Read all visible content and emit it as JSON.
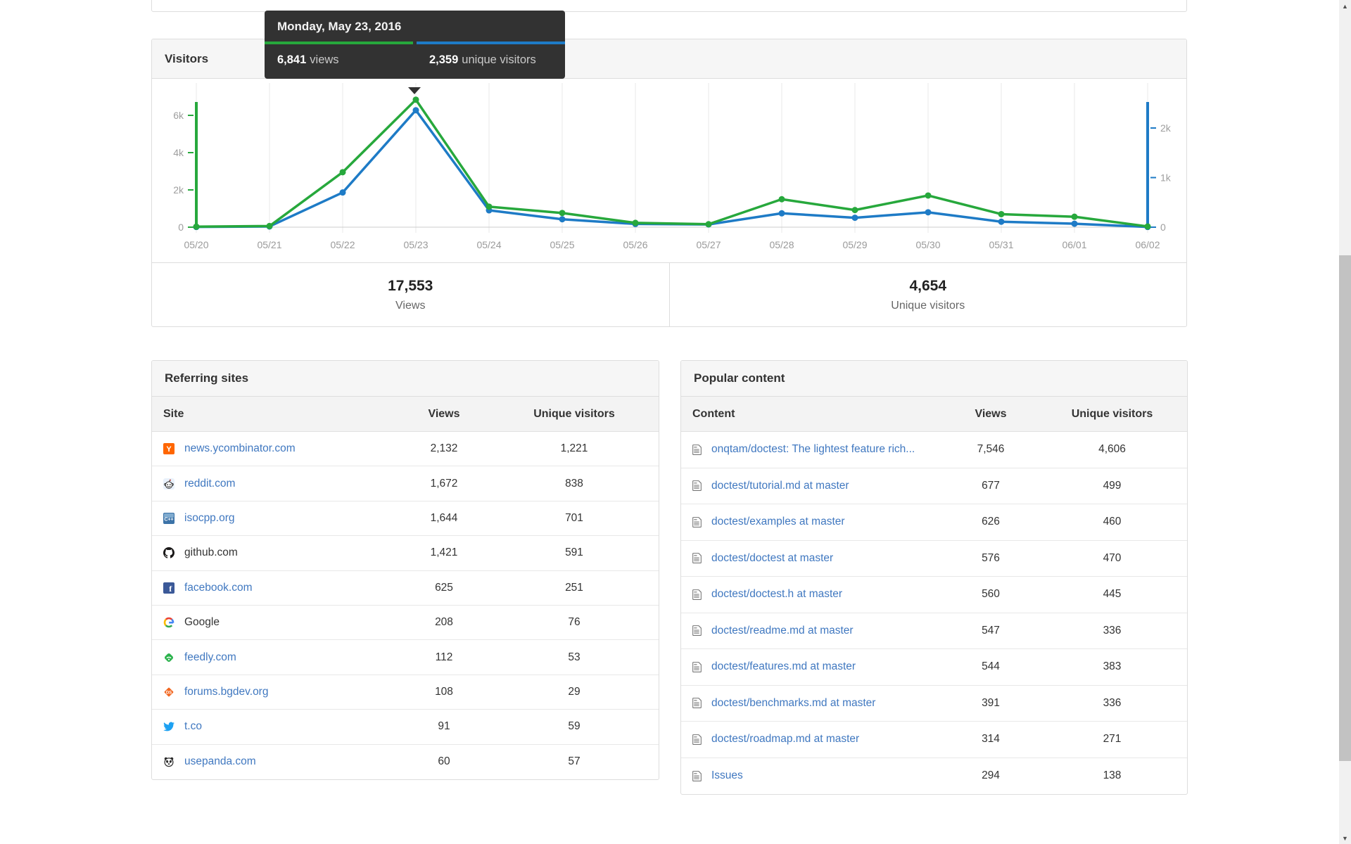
{
  "tooltip": {
    "date": "Monday, May 23, 2016",
    "views_value": "6,841",
    "views_label": "views",
    "unique_value": "2,359",
    "unique_label": "unique visitors"
  },
  "visitors_panel": {
    "title": "Visitors",
    "summary": {
      "views_value": "17,553",
      "views_label": "Views",
      "unique_value": "4,654",
      "unique_label": "Unique visitors"
    }
  },
  "chart_data": {
    "type": "line",
    "title": "Visitors",
    "categories": [
      "05/20",
      "05/21",
      "05/22",
      "05/23",
      "05/24",
      "05/25",
      "05/26",
      "05/27",
      "05/28",
      "05/29",
      "05/30",
      "05/31",
      "06/01",
      "06/02"
    ],
    "series": [
      {
        "name": "views",
        "axis": "left",
        "color": "#27a83c",
        "values": [
          30,
          60,
          2950,
          6841,
          1100,
          760,
          230,
          160,
          1500,
          920,
          1700,
          700,
          560,
          40
        ]
      },
      {
        "name": "unique visitors",
        "axis": "right",
        "color": "#1e7bc6",
        "values": [
          5,
          15,
          700,
          2359,
          340,
          160,
          65,
          55,
          280,
          190,
          300,
          110,
          70,
          5
        ]
      }
    ],
    "left_axis": {
      "tick_values": [
        0,
        2000,
        4000,
        6000
      ],
      "tick_labels": [
        "0",
        "2k",
        "4k",
        "6k"
      ],
      "max": 6700,
      "color": "#27a83c"
    },
    "right_axis": {
      "tick_values": [
        0,
        1000,
        2000
      ],
      "tick_labels": [
        "0",
        "1k",
        "2k"
      ],
      "max": 2520,
      "color": "#1e7bc6"
    },
    "highlight_index": 3,
    "grid": true,
    "note": "values at 05/23 are exact (tooltip); other points estimated from plot; totals: 17,553 views / 4,654 unique"
  },
  "referring_sites": {
    "title": "Referring sites",
    "columns": [
      "Site",
      "Views",
      "Unique visitors"
    ],
    "rows": [
      {
        "site": "news.ycombinator.com",
        "icon": "hackernews",
        "views": "2,132",
        "unique": "1,221",
        "link": true
      },
      {
        "site": "reddit.com",
        "icon": "reddit",
        "views": "1,672",
        "unique": "838",
        "link": true
      },
      {
        "site": "isocpp.org",
        "icon": "isocpp",
        "views": "1,644",
        "unique": "701",
        "link": true
      },
      {
        "site": "github.com",
        "icon": "github",
        "views": "1,421",
        "unique": "591",
        "link": false
      },
      {
        "site": "facebook.com",
        "icon": "facebook",
        "views": "625",
        "unique": "251",
        "link": true
      },
      {
        "site": "Google",
        "icon": "google",
        "views": "208",
        "unique": "76",
        "link": false
      },
      {
        "site": "feedly.com",
        "icon": "feedly",
        "views": "112",
        "unique": "53",
        "link": true
      },
      {
        "site": "forums.bgdev.org",
        "icon": "bgdev",
        "views": "108",
        "unique": "29",
        "link": true
      },
      {
        "site": "t.co",
        "icon": "twitter",
        "views": "91",
        "unique": "59",
        "link": true
      },
      {
        "site": "usepanda.com",
        "icon": "panda",
        "views": "60",
        "unique": "57",
        "link": true
      }
    ]
  },
  "popular_content": {
    "title": "Popular content",
    "columns": [
      "Content",
      "Views",
      "Unique visitors"
    ],
    "rows": [
      {
        "content": "onqtam/doctest: The lightest feature rich...",
        "views": "7,546",
        "unique": "4,606"
      },
      {
        "content": "doctest/tutorial.md at master",
        "views": "677",
        "unique": "499"
      },
      {
        "content": "doctest/examples at master",
        "views": "626",
        "unique": "460"
      },
      {
        "content": "doctest/doctest at master",
        "views": "576",
        "unique": "470"
      },
      {
        "content": "doctest/doctest.h at master",
        "views": "560",
        "unique": "445"
      },
      {
        "content": "doctest/readme.md at master",
        "views": "547",
        "unique": "336"
      },
      {
        "content": "doctest/features.md at master",
        "views": "544",
        "unique": "383"
      },
      {
        "content": "doctest/benchmarks.md at master",
        "views": "391",
        "unique": "336"
      },
      {
        "content": "doctest/roadmap.md at master",
        "views": "314",
        "unique": "271"
      },
      {
        "content": "Issues",
        "views": "294",
        "unique": "138"
      }
    ]
  },
  "scrollbar": {
    "up_glyph": "▲",
    "down_glyph": "▼"
  }
}
